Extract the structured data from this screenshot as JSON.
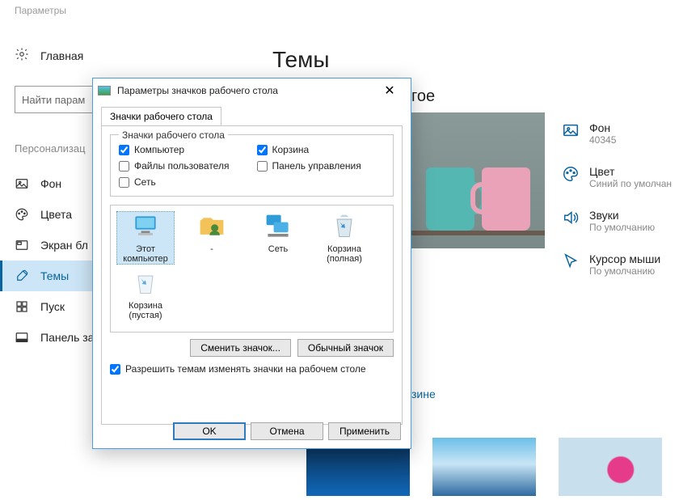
{
  "window_title": "Параметры",
  "home_label": "Главная",
  "search_placeholder": "Найти парам",
  "page_title": "Темы",
  "section_label": "Персонализац",
  "right_heading_fragment": "гое",
  "blue_link_fragment": "зине",
  "sidebar": [
    {
      "icon": "picture",
      "label": "Фон"
    },
    {
      "icon": "palette",
      "label": "Цвета"
    },
    {
      "icon": "lockscreen",
      "label": "Экран бл"
    },
    {
      "icon": "brush",
      "label": "Темы"
    },
    {
      "icon": "start",
      "label": "Пуск"
    },
    {
      "icon": "taskbar",
      "label": "Панель за"
    }
  ],
  "props": [
    {
      "icon": "picture",
      "title": "Фон",
      "sub": "40345"
    },
    {
      "icon": "palette",
      "title": "Цвет",
      "sub": "Синий по умолчан"
    },
    {
      "icon": "speaker",
      "title": "Звуки",
      "sub": "По умолчанию"
    },
    {
      "icon": "cursor",
      "title": "Курсор мыши",
      "sub": "По умолчанию"
    }
  ],
  "dialog": {
    "title": "Параметры значков рабочего стола",
    "tab": "Значки рабочего стола",
    "group_legend": "Значки рабочего стола",
    "checkboxes": {
      "computer": {
        "label": "Компьютер",
        "checked": true
      },
      "recycle": {
        "label": "Корзина",
        "checked": true
      },
      "userfiles": {
        "label": "Файлы пользователя",
        "checked": false
      },
      "cpanel": {
        "label": "Панель управления",
        "checked": false
      },
      "network": {
        "label": "Сеть",
        "checked": false
      }
    },
    "icons": [
      {
        "name": "Этот компьютер",
        "glyph": "monitor",
        "selected": true
      },
      {
        "name": "-",
        "glyph": "userfolder"
      },
      {
        "name": "Сеть",
        "glyph": "netmonitor"
      },
      {
        "name": "Корзина (полная)",
        "glyph": "binfull"
      },
      {
        "name": "Корзина (пустая)",
        "glyph": "binempty"
      }
    ],
    "change_btn": "Сменить значок...",
    "default_btn": "Обычный значок",
    "allow_themes": "Разрешить темам изменять значки на рабочем столе",
    "ok": "OK",
    "cancel": "Отмена",
    "apply": "Применить"
  }
}
